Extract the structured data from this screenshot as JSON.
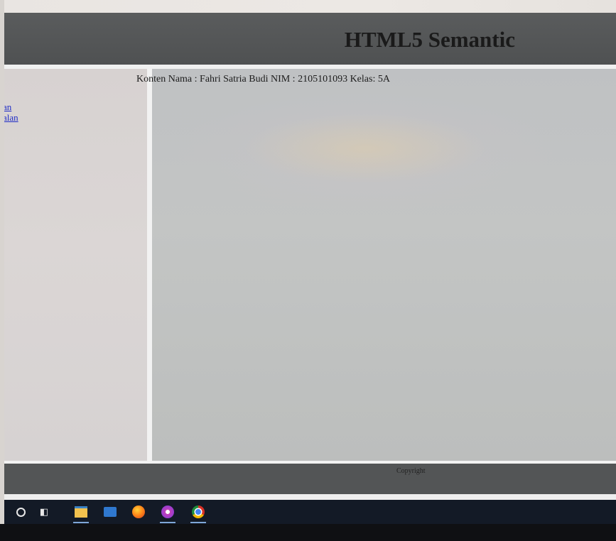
{
  "header": {
    "title": "HTML5 Semantic"
  },
  "nav": {
    "items": [
      {
        "label": "an"
      },
      {
        "label": "alan"
      }
    ]
  },
  "content": {
    "text": "Konten Nama : Fahri Satria Budi NIM : 2105101093 Kelas: 5A"
  },
  "footer": {
    "text": "Copyright"
  },
  "taskbar": {
    "items": [
      {
        "icon": "cortana-circle-icon"
      },
      {
        "icon": "task-view-icon"
      },
      {
        "icon": "file-explorer-icon"
      },
      {
        "icon": "mail-icon"
      },
      {
        "icon": "firefox-icon"
      },
      {
        "icon": "browser-icon"
      },
      {
        "icon": "chrome-icon"
      }
    ]
  }
}
